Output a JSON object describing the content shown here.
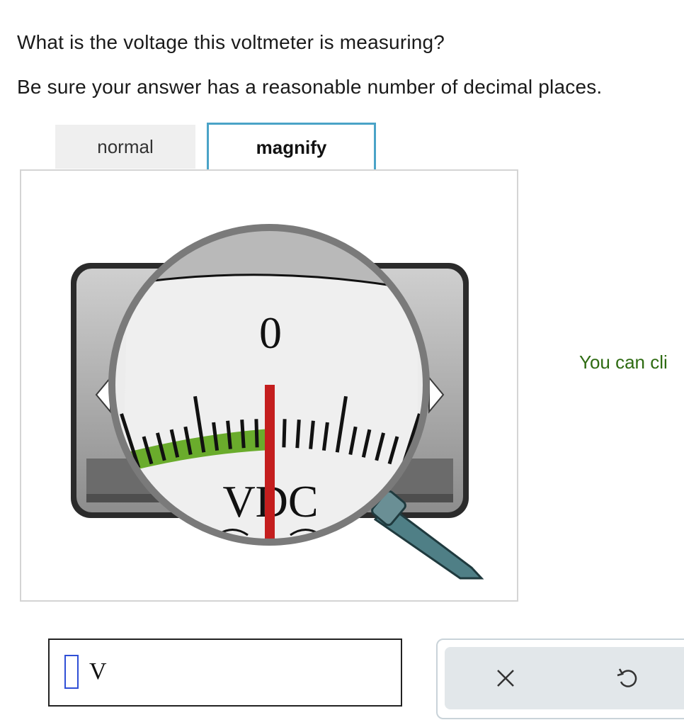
{
  "question": {
    "line1": "What is the voltage this voltmeter is measuring?",
    "line2": "Be sure your answer has a reasonable number of decimal places."
  },
  "tabs": [
    {
      "label": "normal",
      "selected": false
    },
    {
      "label": "magnify",
      "selected": true
    }
  ],
  "meter": {
    "zero_label": "0",
    "unit_label": "VDC",
    "needle_reading": 0,
    "needle_color": "#c41e1e",
    "green_band_color": "#6aac2c",
    "magnifier_handle_color": "#4f7f86"
  },
  "hint": "You can cli",
  "answer": {
    "value": "",
    "unit": "V"
  },
  "tools": {
    "clear_icon": "x-icon",
    "undo_icon": "undo-icon"
  }
}
